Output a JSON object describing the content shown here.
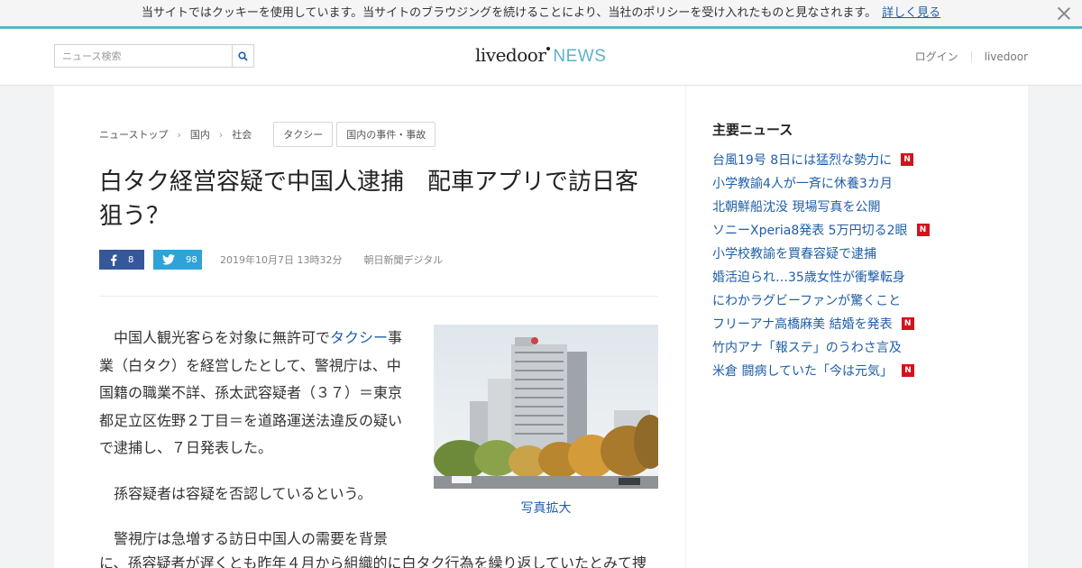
{
  "cookie": {
    "message": "当サイトではクッキーを使用しています。当サイトのブラウジングを続けることにより、当社のポリシーを受け入れたものと見なされます。",
    "link": "詳しく見る"
  },
  "header": {
    "search_placeholder": "ニュース検索",
    "logo_livedoor": "livedoor",
    "logo_news": "NEWS",
    "login": "ログイン",
    "livedoor_link": "livedoor"
  },
  "breadcrumb": [
    "ニューストップ",
    "国内",
    "社会"
  ],
  "tags": [
    "タクシー",
    "国内の事件・事故"
  ],
  "article": {
    "title": "白タク経営容疑で中国人逮捕　配車アプリで訪日客狙う？",
    "fb_count": "8",
    "tw_count": "98",
    "date": "2019年10月7日 13時32分",
    "source": "朝日新聞デジタル",
    "p1_before": "中国人観光客らを対象に無許可で",
    "p1_link": "タクシー",
    "p1_after": "事業（白タク）を経営したとして、警視庁は、中国籍の職業不詳、孫太武容疑者（３７）＝東京都足立区佐野２丁目＝を道路運送法違反の疑いで逮捕し、７日発表した。",
    "p2": "孫容疑者は容疑を否認しているという。",
    "p3_line1": "警視庁は急増する訪日中国人の需要を背景",
    "p3_line2": "に、孫容疑者が遅くとも昨年４月から組織的に白タク行為を繰り返していたとみて捜",
    "photo_caption": "写真拡大"
  },
  "sidebar": {
    "title": "主要ニュース",
    "items": [
      {
        "label": "台風19号 8日には猛烈な勢力に",
        "new": true
      },
      {
        "label": "小学教諭4人が一斉に休養3カ月",
        "new": false
      },
      {
        "label": "北朝鮮船沈没 現場写真を公開",
        "new": false
      },
      {
        "label": "ソニーXperia8発表 5万円切る2眼",
        "new": true
      },
      {
        "label": "小学校教諭を買春容疑で逮捕",
        "new": false
      },
      {
        "label": "婚活迫られ…35歳女性が衝撃転身",
        "new": false
      },
      {
        "label": "にわかラグビーファンが驚くこと",
        "new": false
      },
      {
        "label": "フリーアナ高橋麻美 結婚を発表",
        "new": true
      },
      {
        "label": "竹内アナ「報ステ」のうわさ言及",
        "new": false
      },
      {
        "label": "米倉 闘病していた「今は元気」",
        "new": true
      }
    ],
    "new_badge": "N"
  },
  "colors": {
    "accent": "#5ab4c9",
    "link": "#1f5ea8",
    "facebook": "#35589a",
    "twitter": "#2fa3d9",
    "new_badge": "#d3121c"
  },
  "icons": {
    "search": "search-icon",
    "close": "close-icon",
    "facebook": "facebook-icon",
    "twitter": "twitter-icon"
  }
}
